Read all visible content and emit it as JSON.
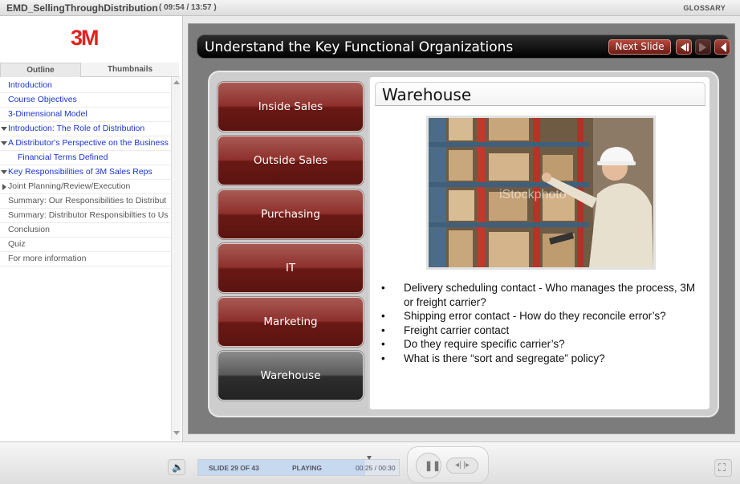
{
  "window": {
    "title": "EMD_SellingThroughDistribution",
    "timer": "( 09:54 / 13:57 )",
    "glossary": "GLOSSARY"
  },
  "sidebar": {
    "logo": "3M",
    "tabs": [
      "Outline",
      "Thumbnails"
    ],
    "items": [
      {
        "label": "Introduction"
      },
      {
        "label": "Course Objectives"
      },
      {
        "label": "3-Dimensional Model"
      },
      {
        "label": "Introduction: The Role of Distribution"
      },
      {
        "label": "A Distributor's Perspective on the Business"
      },
      {
        "label": "Financial Terms Defined"
      },
      {
        "label": "Key Responsibilities of 3M Sales Reps"
      },
      {
        "label": "Joint Planning/Review/Execution"
      },
      {
        "label": "Summary: Our Responsibilities to  Distribut"
      },
      {
        "label": "Summary: Distributor Responsibilties to Us"
      },
      {
        "label": "Conclusion"
      },
      {
        "label": "Quiz"
      },
      {
        "label": "For more information"
      }
    ]
  },
  "slide": {
    "title": "Understand the Key Functional Organizations",
    "next_label": "Next Slide",
    "buttons": [
      {
        "label": "Inside Sales"
      },
      {
        "label": "Outside Sales"
      },
      {
        "label": "Purchasing"
      },
      {
        "label": "IT"
      },
      {
        "label": "Marketing"
      },
      {
        "label": "Warehouse"
      }
    ],
    "active_section": "Warehouse",
    "content_title": "Warehouse",
    "watermark": "iStockphoto",
    "bullets": [
      "Delivery scheduling contact - Who manages the process, 3M or freight carrier?",
      "Shipping error  contact - How do they reconcile error’s?",
      "Freight carrier contact",
      "Do they require specific carrier’s?",
      "What is there “sort and segregate” policy?"
    ],
    "bullet_symbol": "•"
  },
  "player": {
    "slide_counter": "SLIDE 29 OF 43",
    "state": "PLAYING",
    "time": "00:25 / 00:30",
    "progress_fraction": 0.83
  },
  "colors": {
    "logo_red": "#e1221f",
    "link_blue": "#1b35d2",
    "button_red": "#8e302b",
    "active_gray": "#3a3a3a"
  }
}
